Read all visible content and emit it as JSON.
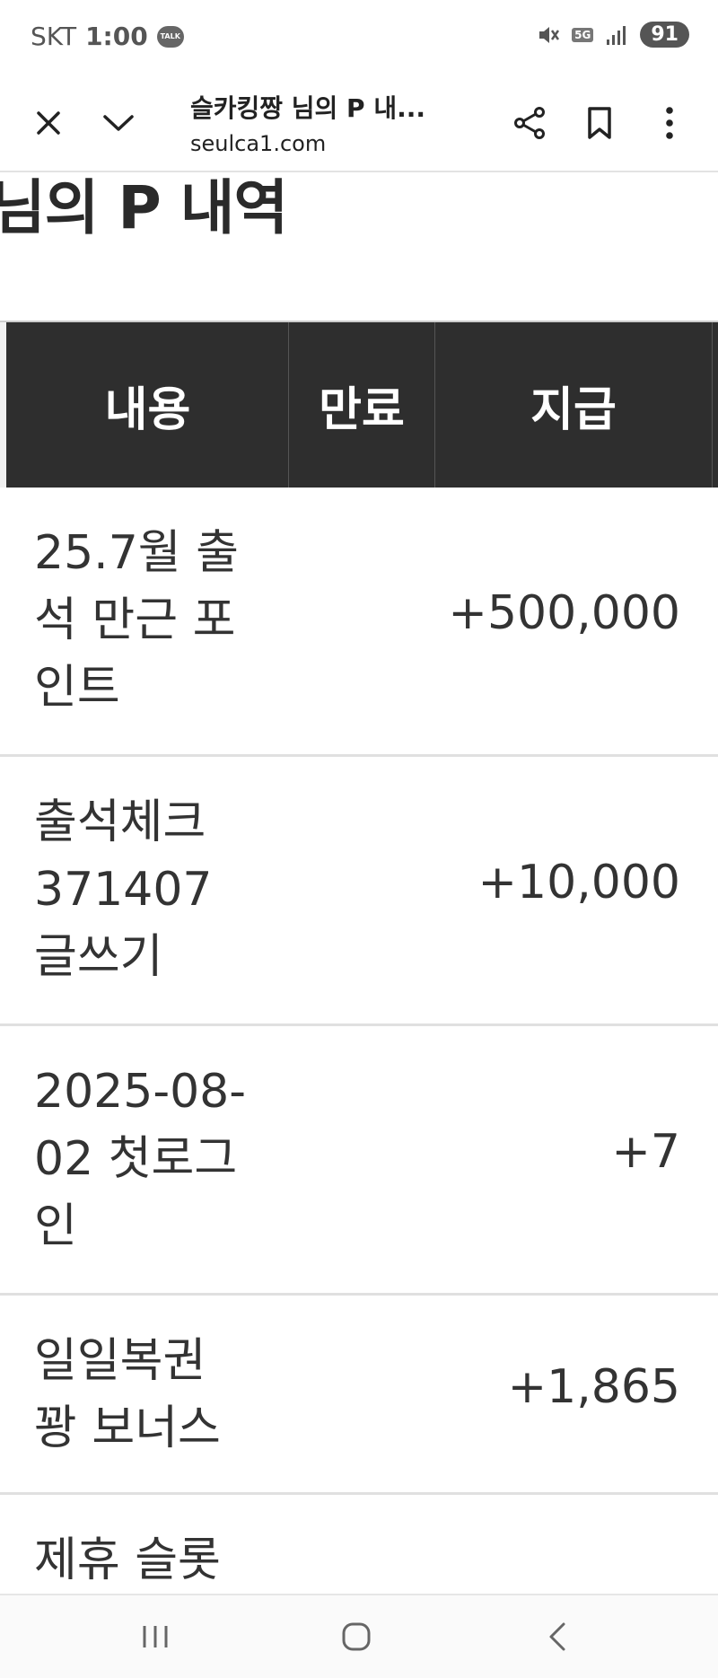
{
  "status_bar": {
    "carrier": "SKT",
    "time": "1:00",
    "talk_badge": "TALK",
    "network": "5G",
    "battery": "91"
  },
  "browser": {
    "title": "슬카킹짱 님의 P 내...",
    "url": "seulca1.com"
  },
  "page": {
    "heading": "님의 P 내역"
  },
  "table": {
    "headers": {
      "content": "내용",
      "expiry": "만료",
      "grant": "지급"
    },
    "rows": [
      {
        "content": "25.7월 출석 만근 포인트",
        "expiry": "",
        "amount": "+500,000"
      },
      {
        "content": "출석체크 371407 글쓰기",
        "expiry": "",
        "amount": "+10,000"
      },
      {
        "content": "2025-08-02 첫로그인",
        "expiry": "",
        "amount": "+7"
      },
      {
        "content": "일일복권 꽝 보너스",
        "expiry": "",
        "amount": "+1,865"
      },
      {
        "content": "제휴 슬롯",
        "expiry": "",
        "amount": ""
      }
    ]
  },
  "navbar": {
    "recents_icon": "recents-icon",
    "home_icon": "home-icon",
    "back_icon": "back-icon"
  }
}
